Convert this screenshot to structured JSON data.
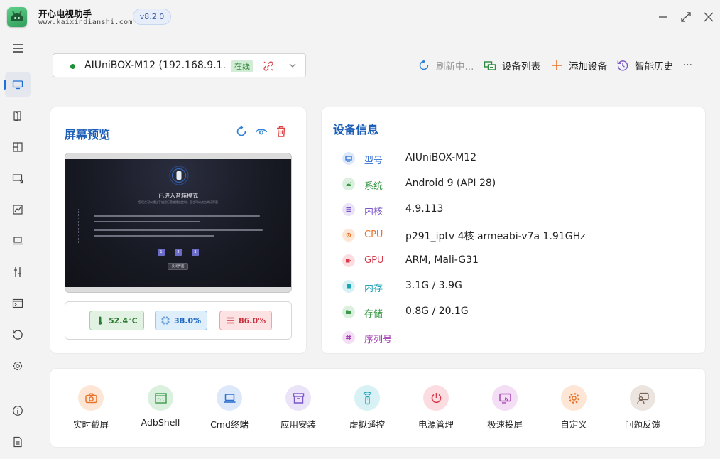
{
  "app": {
    "name": "开心电视助手",
    "site": "www.kaixindianshi.com",
    "version": "v8.2.0"
  },
  "device": {
    "name": "AIUniBOX-M12 (192.168.9.1...",
    "status": "在线"
  },
  "toolbar": {
    "refresh": "刷新中...",
    "device_list": "设备列表",
    "add_device": "添加设备",
    "history": "智能历史",
    "more": "···"
  },
  "preview": {
    "title": "屏幕预览",
    "screen": {
      "mode_title": "已进入音箱模式",
      "mode_sub": "您现在可以通过手机进行音箱播放控制，您也可以点击关闭界面",
      "keys": [
        "1",
        "2",
        "3"
      ],
      "close": "关闭界面"
    },
    "stats": {
      "temperature": "52.4°C",
      "cpu": "38.0%",
      "memory": "86.0%"
    }
  },
  "info": {
    "title": "设备信息",
    "rows": [
      {
        "label": "型号",
        "value": "AIUniBOX-M12",
        "color": "#2f6fd0",
        "bg": "#dde9fb",
        "icon": "monitor-icon"
      },
      {
        "label": "系统",
        "value": "Android 9 (API 28)",
        "color": "#3b9a4a",
        "bg": "#dcf0df",
        "icon": "android-icon"
      },
      {
        "label": "内核",
        "value": "4.9.113",
        "color": "#7b57c9",
        "bg": "#ebe3f8",
        "icon": "list-icon"
      },
      {
        "label": "CPU",
        "value": "p291_iptv 4核 armeabi-v7a 1.91GHz",
        "color": "#e8732a",
        "bg": "#fde6d6",
        "icon": "chip-icon"
      },
      {
        "label": "GPU",
        "value": "ARM, Mali-G31",
        "color": "#d63b4b",
        "bg": "#fbdde1",
        "icon": "video-icon"
      },
      {
        "label": "内存",
        "value": "3.1G / 3.9G",
        "color": "#1ca3b5",
        "bg": "#d7f1f4",
        "icon": "memory-icon"
      },
      {
        "label": "存储",
        "value": "0.8G / 20.1G",
        "color": "#3b9a4a",
        "bg": "#dcf0df",
        "icon": "folder-icon"
      },
      {
        "label": "序列号",
        "value": "",
        "color": "#a33bb2",
        "bg": "#f3def5",
        "icon": "hash-icon"
      }
    ]
  },
  "actions": [
    {
      "label": "实时截屏",
      "icon": "camera-icon",
      "color": "#e8732a",
      "bg": "#fde6d6"
    },
    {
      "label": "AdbShell",
      "icon": "terminal-icon",
      "color": "#3b9a4a",
      "bg": "#dcf0df"
    },
    {
      "label": "Cmd终端",
      "icon": "laptop-icon",
      "color": "#2f6fd0",
      "bg": "#dde9fb"
    },
    {
      "label": "应用安装",
      "icon": "box-icon",
      "color": "#7b57c9",
      "bg": "#ebe3f8"
    },
    {
      "label": "虚拟遥控",
      "icon": "remote-icon",
      "color": "#1ca3b5",
      "bg": "#d7f1f4"
    },
    {
      "label": "电源管理",
      "icon": "power-icon",
      "color": "#d63b4b",
      "bg": "#fbdde1"
    },
    {
      "label": "极速投屏",
      "icon": "cast-icon",
      "color": "#a33bb2",
      "bg": "#f3def5"
    },
    {
      "label": "自定义",
      "icon": "gear-icon",
      "color": "#e8732a",
      "bg": "#fde6d6"
    },
    {
      "label": "问题反馈",
      "icon": "feedback-icon",
      "color": "#7a6458",
      "bg": "#ebe4df"
    }
  ]
}
